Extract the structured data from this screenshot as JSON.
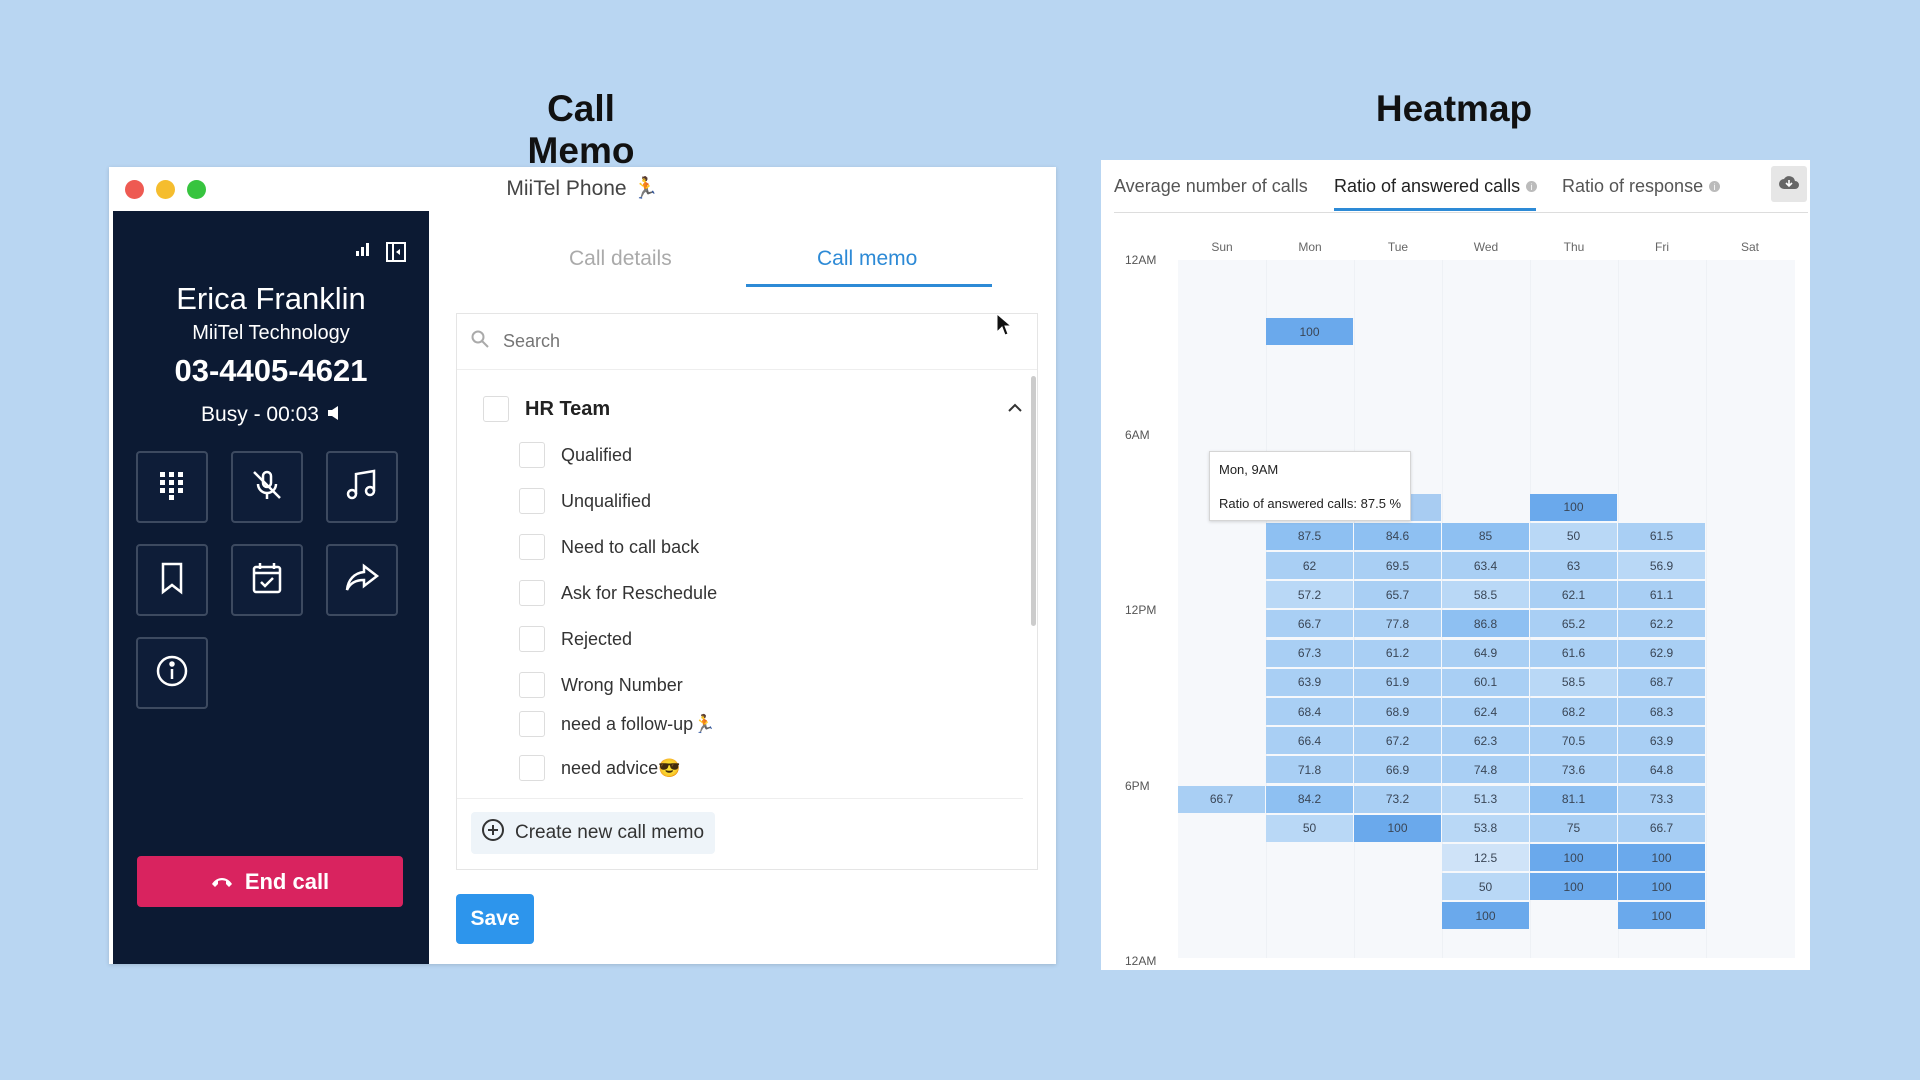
{
  "section_titles": {
    "left": "Call Memo",
    "right": "Heatmap"
  },
  "phone": {
    "window_title": "MiiTel Phone",
    "contact": {
      "name": "Erica Franklin",
      "company": "MiiTel Technology",
      "number": "03-4405-4621",
      "status": "Busy - 00:03"
    },
    "controls": [
      "dialpad-icon",
      "mute-icon",
      "music-icon",
      "bookmark-icon",
      "calendar-check-icon",
      "forward-icon",
      "info-icon"
    ],
    "end_call_label": "End call",
    "colors": {
      "sidebar": "#0c1a33",
      "end_call": "#d9235f",
      "accent": "#2d8ad6"
    },
    "tabs": [
      "Call details",
      "Call memo"
    ],
    "active_tab": "Call memo",
    "search_placeholder": "Search",
    "group": "HR Team",
    "memo_items": [
      "Qualified",
      "Unqualified",
      "Need to call back",
      "Ask for Reschedule",
      "Rejected",
      "Wrong Number",
      "need a follow-up🏃",
      "need advice😎"
    ],
    "create_label": "Create new call memo",
    "save_label": "Save"
  },
  "heatmap": {
    "tabs": [
      "Average number of calls",
      "Ratio of answered calls",
      "Ratio of response"
    ],
    "active_tab": "Ratio of answered calls",
    "days": [
      "Sun",
      "Mon",
      "Tue",
      "Wed",
      "Thu",
      "Fri",
      "Sat"
    ],
    "time_labels": [
      "12AM",
      "6AM",
      "12PM",
      "6PM",
      "12AM"
    ],
    "tooltip": {
      "title": "Mon, 9AM",
      "body": "Ratio of answered calls: 87.5 %"
    },
    "cells": [
      {
        "day": "Mon",
        "hour": 2,
        "value": "100"
      },
      {
        "day": "Tue",
        "hour": 8,
        "value": ""
      },
      {
        "day": "Thu",
        "hour": 8,
        "value": "100"
      },
      {
        "day": "Mon",
        "hour": 9,
        "value": "87.5"
      },
      {
        "day": "Tue",
        "hour": 9,
        "value": "84.6"
      },
      {
        "day": "Wed",
        "hour": 9,
        "value": "85"
      },
      {
        "day": "Thu",
        "hour": 9,
        "value": "50"
      },
      {
        "day": "Fri",
        "hour": 9,
        "value": "61.5"
      },
      {
        "day": "Mon",
        "hour": 10,
        "value": "62"
      },
      {
        "day": "Tue",
        "hour": 10,
        "value": "69.5"
      },
      {
        "day": "Wed",
        "hour": 10,
        "value": "63.4"
      },
      {
        "day": "Thu",
        "hour": 10,
        "value": "63"
      },
      {
        "day": "Fri",
        "hour": 10,
        "value": "56.9"
      },
      {
        "day": "Mon",
        "hour": 11,
        "value": "57.2"
      },
      {
        "day": "Tue",
        "hour": 11,
        "value": "65.7"
      },
      {
        "day": "Wed",
        "hour": 11,
        "value": "58.5"
      },
      {
        "day": "Thu",
        "hour": 11,
        "value": "62.1"
      },
      {
        "day": "Fri",
        "hour": 11,
        "value": "61.1"
      },
      {
        "day": "Mon",
        "hour": 12,
        "value": "66.7"
      },
      {
        "day": "Tue",
        "hour": 12,
        "value": "77.8"
      },
      {
        "day": "Wed",
        "hour": 12,
        "value": "86.8"
      },
      {
        "day": "Thu",
        "hour": 12,
        "value": "65.2"
      },
      {
        "day": "Fri",
        "hour": 12,
        "value": "62.2"
      },
      {
        "day": "Mon",
        "hour": 13,
        "value": "67.3"
      },
      {
        "day": "Tue",
        "hour": 13,
        "value": "61.2"
      },
      {
        "day": "Wed",
        "hour": 13,
        "value": "64.9"
      },
      {
        "day": "Thu",
        "hour": 13,
        "value": "61.6"
      },
      {
        "day": "Fri",
        "hour": 13,
        "value": "62.9"
      },
      {
        "day": "Mon",
        "hour": 14,
        "value": "63.9"
      },
      {
        "day": "Tue",
        "hour": 14,
        "value": "61.9"
      },
      {
        "day": "Wed",
        "hour": 14,
        "value": "60.1"
      },
      {
        "day": "Thu",
        "hour": 14,
        "value": "58.5"
      },
      {
        "day": "Fri",
        "hour": 14,
        "value": "68.7"
      },
      {
        "day": "Mon",
        "hour": 15,
        "value": "68.4"
      },
      {
        "day": "Tue",
        "hour": 15,
        "value": "68.9"
      },
      {
        "day": "Wed",
        "hour": 15,
        "value": "62.4"
      },
      {
        "day": "Thu",
        "hour": 15,
        "value": "68.2"
      },
      {
        "day": "Fri",
        "hour": 15,
        "value": "68.3"
      },
      {
        "day": "Mon",
        "hour": 16,
        "value": "66.4"
      },
      {
        "day": "Tue",
        "hour": 16,
        "value": "67.2"
      },
      {
        "day": "Wed",
        "hour": 16,
        "value": "62.3"
      },
      {
        "day": "Thu",
        "hour": 16,
        "value": "70.5"
      },
      {
        "day": "Fri",
        "hour": 16,
        "value": "63.9"
      },
      {
        "day": "Mon",
        "hour": 17,
        "value": "71.8"
      },
      {
        "day": "Tue",
        "hour": 17,
        "value": "66.9"
      },
      {
        "day": "Wed",
        "hour": 17,
        "value": "74.8"
      },
      {
        "day": "Thu",
        "hour": 17,
        "value": "73.6"
      },
      {
        "day": "Fri",
        "hour": 17,
        "value": "64.8"
      },
      {
        "day": "Sun",
        "hour": 18,
        "value": "66.7"
      },
      {
        "day": "Mon",
        "hour": 18,
        "value": "84.2"
      },
      {
        "day": "Tue",
        "hour": 18,
        "value": "73.2"
      },
      {
        "day": "Wed",
        "hour": 18,
        "value": "51.3"
      },
      {
        "day": "Thu",
        "hour": 18,
        "value": "81.1"
      },
      {
        "day": "Fri",
        "hour": 18,
        "value": "73.3"
      },
      {
        "day": "Mon",
        "hour": 19,
        "value": "50"
      },
      {
        "day": "Tue",
        "hour": 19,
        "value": "100"
      },
      {
        "day": "Wed",
        "hour": 19,
        "value": "53.8"
      },
      {
        "day": "Thu",
        "hour": 19,
        "value": "75"
      },
      {
        "day": "Fri",
        "hour": 19,
        "value": "66.7"
      },
      {
        "day": "Wed",
        "hour": 20,
        "value": "12.5"
      },
      {
        "day": "Thu",
        "hour": 20,
        "value": "100"
      },
      {
        "day": "Fri",
        "hour": 20,
        "value": "100"
      },
      {
        "day": "Wed",
        "hour": 21,
        "value": "50"
      },
      {
        "day": "Thu",
        "hour": 21,
        "value": "100"
      },
      {
        "day": "Fri",
        "hour": 21,
        "value": "100"
      },
      {
        "day": "Wed",
        "hour": 22,
        "value": "100"
      },
      {
        "day": "Fri",
        "hour": 22,
        "value": "100"
      }
    ]
  }
}
